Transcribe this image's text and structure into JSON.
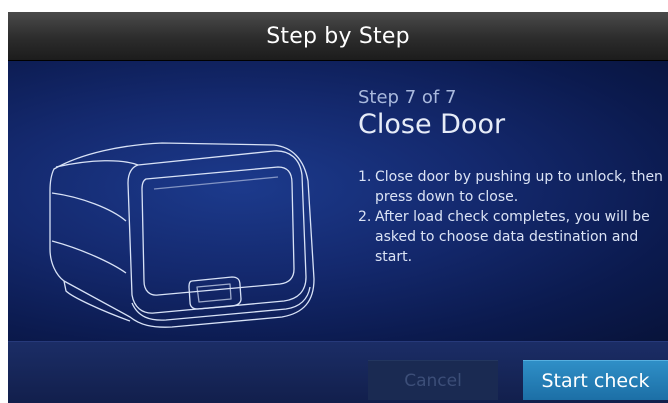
{
  "header": {
    "title": "Step by Step"
  },
  "step": {
    "label": "Step 7 of 7",
    "title": "Close Door",
    "instructions": [
      {
        "num": "1.",
        "text": "Close door by pushing up to unlock, then press down to close."
      },
      {
        "num": "2.",
        "text": "After load check completes, you will be asked to choose data destination and start."
      }
    ]
  },
  "footer": {
    "cancel_label": "Cancel",
    "start_label": "Start check"
  },
  "colors": {
    "content_bg": "#14296e",
    "start_button": "#2580b8",
    "cancel_button_disabled": "#1a2a52",
    "title_bar": "#2c2c2c"
  },
  "icons": {
    "illustration": "instrument-device-illustration"
  }
}
